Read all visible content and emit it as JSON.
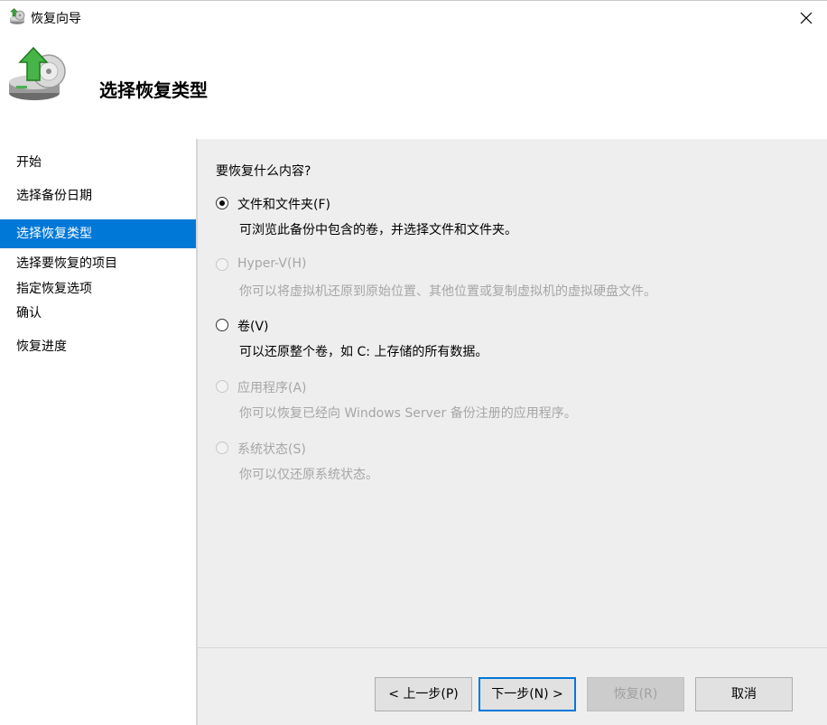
{
  "window": {
    "title": "恢复向导",
    "close_glyph": "✕"
  },
  "header": {
    "title": "选择恢复类型",
    "icon": "backup-restore-icon"
  },
  "nav": {
    "items": [
      {
        "label": "开始"
      },
      {
        "label": "选择备份日期"
      },
      {
        "label": "选择恢复类型"
      },
      {
        "label": "选择要恢复的项目"
      },
      {
        "label": "指定恢复选项"
      },
      {
        "label": "确认"
      },
      {
        "label": "恢复进度"
      }
    ],
    "selected_index": 2
  },
  "content": {
    "question": "要恢复什么内容?",
    "options": [
      {
        "label": "文件和文件夹(F)",
        "desc": "可浏览此备份中包含的卷，并选择文件和文件夹。",
        "checked": true,
        "enabled": true
      },
      {
        "label": "Hyper-V(H)",
        "desc": "你可以将虚拟机还原到原始位置、其他位置或复制虚拟机的虚拟硬盘文件。",
        "checked": false,
        "enabled": false
      },
      {
        "label": "卷(V)",
        "desc": "可以还原整个卷，如 C: 上存储的所有数据。",
        "checked": false,
        "enabled": true
      },
      {
        "label": "应用程序(A)",
        "desc": "你可以恢复已经向 Windows Server 备份注册的应用程序。",
        "checked": false,
        "enabled": false
      },
      {
        "label": "系统状态(S)",
        "desc": "你可以仅还原系统状态。",
        "checked": false,
        "enabled": false
      }
    ]
  },
  "footer": {
    "prev_label": "< 上一步(P)",
    "next_label": "下一步(N) >",
    "recover_label": "恢复(R)",
    "cancel_label": "取消"
  },
  "colors": {
    "accent": "#0078d7",
    "content_bg": "#eeeeee",
    "disabled_text": "#a6a6a6"
  }
}
